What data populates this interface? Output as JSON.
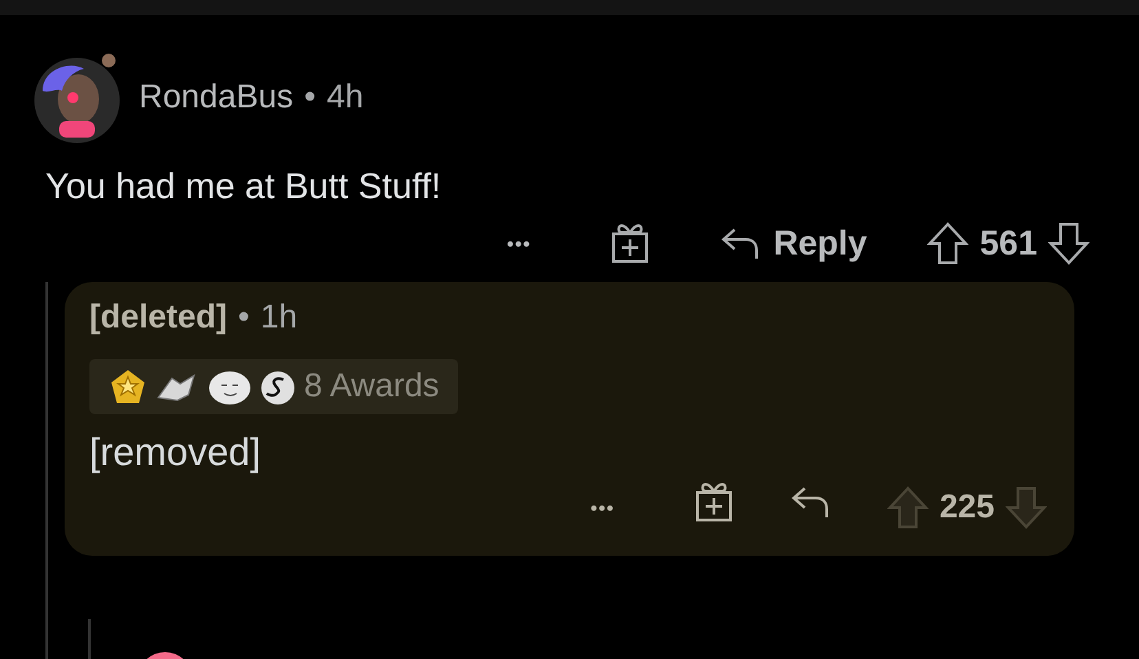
{
  "comment": {
    "author": "RondaBus",
    "separator": "•",
    "time": "4h",
    "body": "You had me at Butt Stuff!",
    "actions": {
      "more": "•••",
      "reply": "Reply",
      "score": "561"
    }
  },
  "reply": {
    "author": "[deleted]",
    "separator": "•",
    "time": "1h",
    "awards_label": "8 Awards",
    "body": "[removed]",
    "actions": {
      "more": "•••",
      "score": "225"
    }
  }
}
